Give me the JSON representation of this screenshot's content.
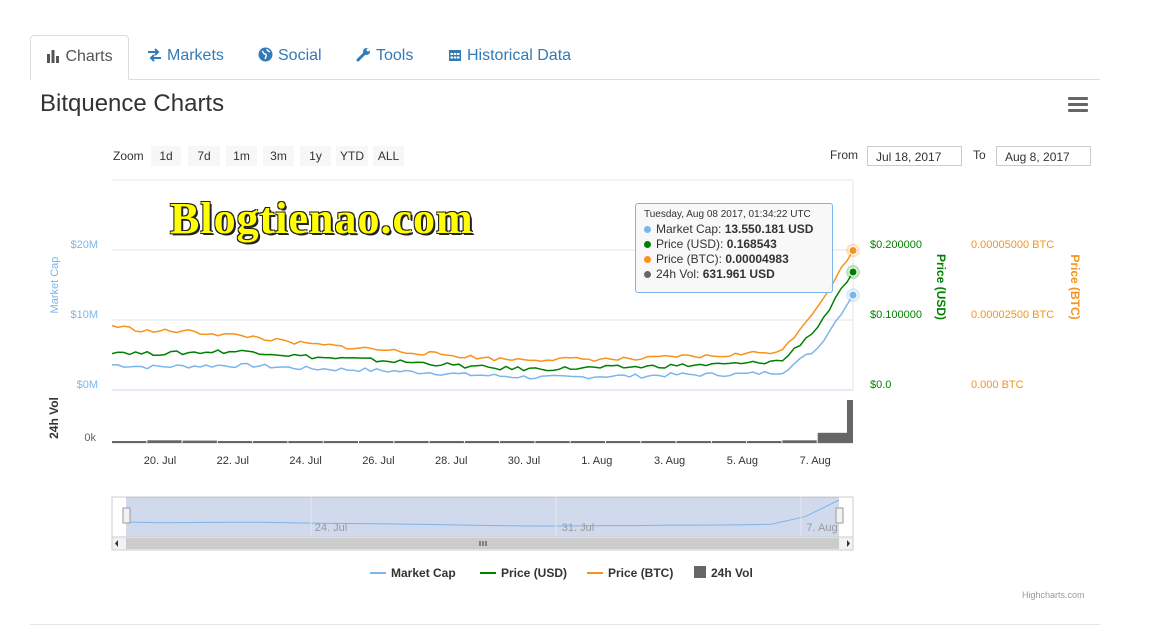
{
  "tabs": [
    {
      "label": "Charts",
      "icon": "bar-chart-icon",
      "active": true
    },
    {
      "label": "Markets",
      "icon": "exchange-arrows-icon"
    },
    {
      "label": "Social",
      "icon": "globe-icon"
    },
    {
      "label": "Tools",
      "icon": "wrench-icon"
    },
    {
      "label": "Historical Data",
      "icon": "calendar-icon"
    }
  ],
  "page_title": "Bitquence Charts",
  "menu_icon": "hamburger-menu-icon",
  "zoom": {
    "label": "Zoom",
    "buttons": [
      "1d",
      "7d",
      "1m",
      "3m",
      "1y",
      "YTD",
      "ALL"
    ]
  },
  "range": {
    "from_label": "From",
    "from": "Jul 18, 2017",
    "to_label": "To",
    "to": "Aug 8, 2017"
  },
  "watermark": "Blogtienao.com",
  "tooltip": {
    "date": "Tuesday, Aug 08 2017, 01:34:22 UTC",
    "rows": [
      {
        "name": "Market Cap",
        "value": "13.550.181 USD",
        "color": "#7cb5ec"
      },
      {
        "name": "Price (USD)",
        "value": "0.168543",
        "color": "#008000"
      },
      {
        "name": "Price (BTC)",
        "value": "0.00004983",
        "color": "#f7931a"
      },
      {
        "name": "24h Vol",
        "value": "631.961 USD",
        "color": "#666666"
      }
    ]
  },
  "legend": [
    {
      "name": "Market Cap",
      "color": "#7cb5ec",
      "kind": "line"
    },
    {
      "name": "Price (USD)",
      "color": "#008000",
      "kind": "line"
    },
    {
      "name": "Price (BTC)",
      "color": "#f7931a",
      "kind": "line"
    },
    {
      "name": "24h Vol",
      "color": "#666666",
      "kind": "box"
    }
  ],
  "credits": "Highcharts.com",
  "chart_data": {
    "type": "line",
    "x": [
      "2017-07-18",
      "2017-07-19",
      "2017-07-20",
      "2017-07-21",
      "2017-07-22",
      "2017-07-23",
      "2017-07-24",
      "2017-07-25",
      "2017-07-26",
      "2017-07-27",
      "2017-07-28",
      "2017-07-29",
      "2017-07-30",
      "2017-07-31",
      "2017-08-01",
      "2017-08-02",
      "2017-08-03",
      "2017-08-04",
      "2017-08-05",
      "2017-08-06",
      "2017-08-07",
      "2017-08-08"
    ],
    "series": [
      {
        "name": "Market Cap",
        "axis": "left",
        "color": "#7cb5ec",
        "values": [
          3.6,
          3.3,
          3.4,
          3.5,
          3.5,
          3.2,
          3.0,
          2.9,
          2.7,
          2.5,
          2.2,
          2.0,
          1.8,
          1.8,
          2.0,
          2.0,
          2.2,
          2.2,
          2.3,
          2.6,
          6.0,
          13.55
        ]
      },
      {
        "name": "Price (USD)",
        "axis": "usd",
        "color": "#008000",
        "values": [
          0.055,
          0.052,
          0.053,
          0.055,
          0.055,
          0.05,
          0.046,
          0.044,
          0.041,
          0.038,
          0.034,
          0.031,
          0.03,
          0.031,
          0.032,
          0.033,
          0.035,
          0.036,
          0.038,
          0.042,
          0.09,
          0.168543
        ]
      },
      {
        "name": "Price (BTC)",
        "axis": "btc",
        "color": "#f7931a",
        "values": [
          2.3e-05,
          2.1e-05,
          2.1e-05,
          2e-05,
          1.9e-05,
          1.7e-05,
          1.6e-05,
          1.5e-05,
          1.4e-05,
          1.3e-05,
          1.2e-05,
          1.1e-05,
          1.1e-05,
          1.1e-05,
          1.1e-05,
          1.1e-05,
          1.2e-05,
          1.2e-05,
          1.3e-05,
          1.4e-05,
          3e-05,
          4.983e-05
        ]
      },
      {
        "name": "24h Vol",
        "axis": "vol",
        "color": "#666666",
        "values": [
          20,
          40,
          35,
          30,
          25,
          20,
          15,
          12,
          12,
          10,
          8,
          10,
          15,
          10,
          12,
          10,
          10,
          15,
          20,
          40,
          150,
          631.961
        ]
      }
    ],
    "x_tick_labels": [
      "20. Jul",
      "22. Jul",
      "24. Jul",
      "26. Jul",
      "28. Jul",
      "30. Jul",
      "1. Aug",
      "3. Aug",
      "5. Aug",
      "7. Aug"
    ],
    "y_left": {
      "label": "Market Cap",
      "ticks": [
        "$0M",
        "$10M",
        "$20M"
      ],
      "range": [
        0,
        30
      ]
    },
    "y_usd": {
      "label": "Price (USD)",
      "ticks": [
        "$0.0",
        "$0.100000",
        "$0.200000"
      ],
      "range": [
        0,
        0.3
      ]
    },
    "y_btc": {
      "label": "Price (BTC)",
      "ticks": [
        "0.000 BTC",
        "0.00002500 BTC",
        "0.00005000 BTC"
      ],
      "range": [
        0,
        7.5e-05
      ]
    },
    "y_vol": {
      "label": "24h Vol",
      "ticks": [
        "0k"
      ]
    },
    "navigator_labels": [
      "24. Jul",
      "31. Jul",
      "7. Aug"
    ],
    "grid": true
  }
}
